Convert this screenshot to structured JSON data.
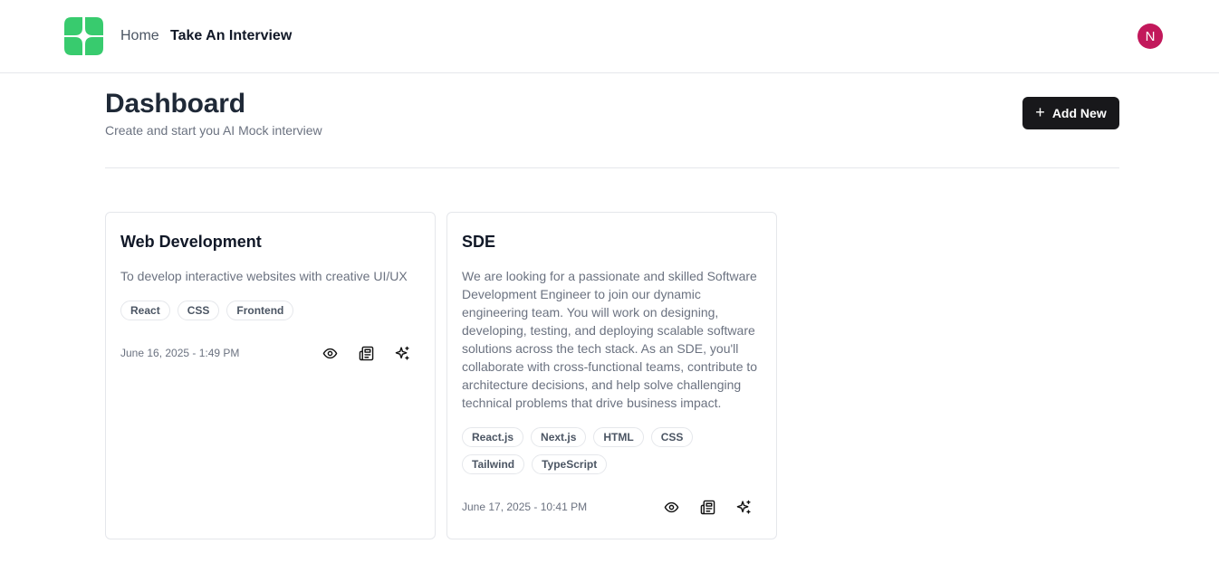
{
  "nav": {
    "home": "Home",
    "take_interview": "Take An Interview",
    "avatar_initial": "N"
  },
  "colors": {
    "brand": "#22c55e",
    "avatar": "#c2185b",
    "primary_button": "#18181b"
  },
  "page": {
    "title": "Dashboard",
    "subtitle": "Create and start you AI Mock interview",
    "add_new_label": "Add New",
    "add_new_icon": "plus-icon"
  },
  "cards": [
    {
      "title": "Web Development",
      "description": "To develop interactive websites with creative UI/UX",
      "tags": [
        "React",
        "CSS",
        "Frontend"
      ],
      "date": "June 16, 2025 - 1:49 PM",
      "actions": [
        "eye-icon",
        "newspaper-icon",
        "sparkles-icon"
      ]
    },
    {
      "title": "SDE",
      "description": "We are looking for a passionate and skilled Software Development Engineer to join our dynamic engineering team. You will work on designing, developing, testing, and deploying scalable software solutions across the tech stack. As an SDE, you'll collaborate with cross-functional teams, contribute to architecture decisions, and help solve challenging technical problems that drive business impact.",
      "tags": [
        "React.js",
        "Next.js",
        "HTML",
        "CSS",
        "Tailwind",
        "TypeScript"
      ],
      "date": "June 17, 2025 - 10:41 PM",
      "actions": [
        "eye-icon",
        "newspaper-icon",
        "sparkles-icon"
      ]
    }
  ]
}
